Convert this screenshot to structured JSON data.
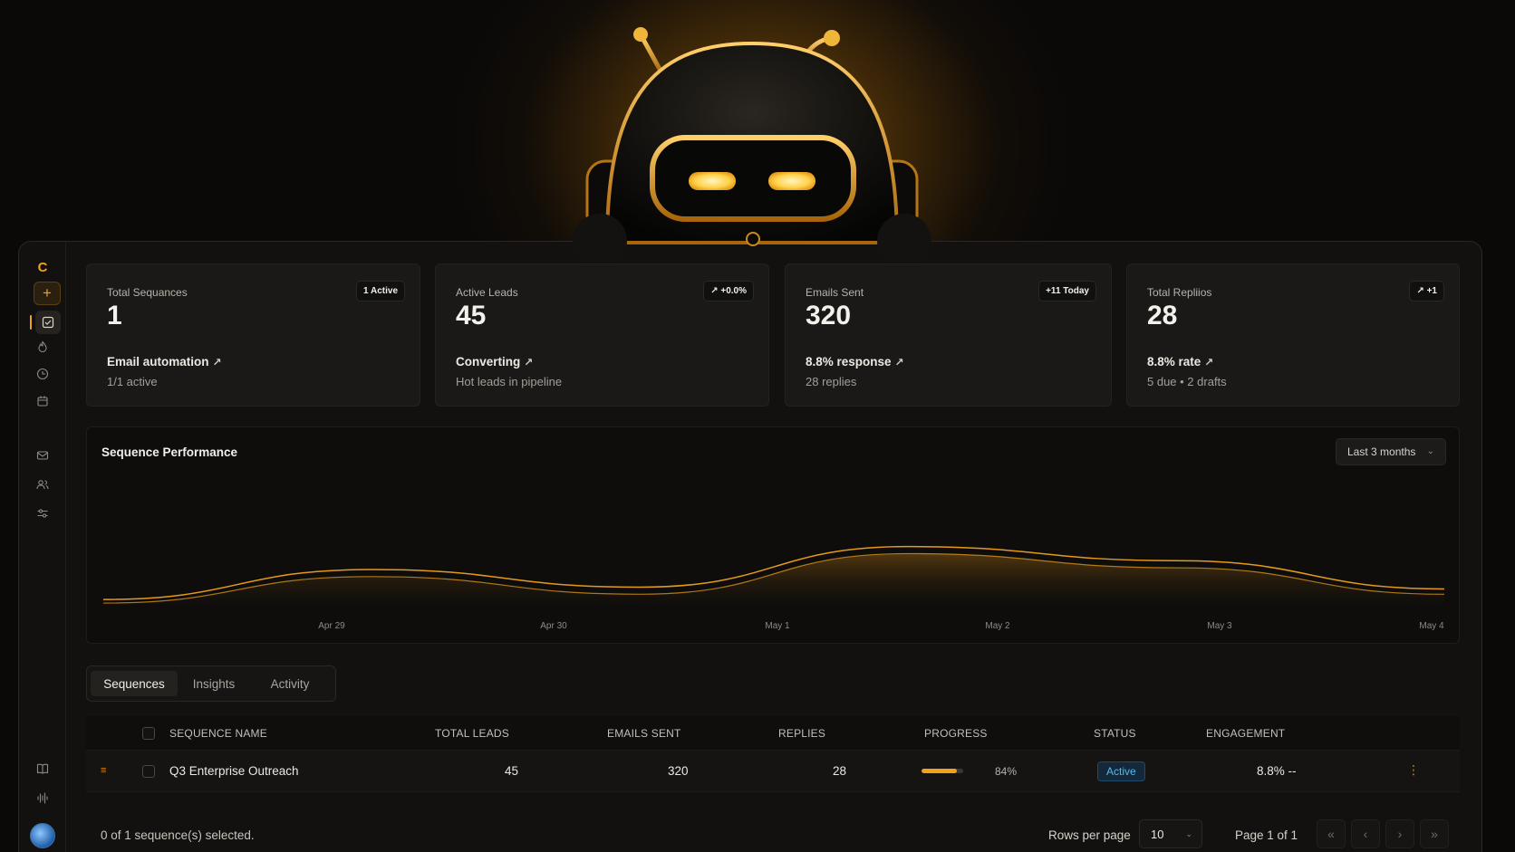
{
  "sidebar": {
    "logo_glyph": "C",
    "add_glyph": "+",
    "icons": [
      "sequences-icon",
      "fire-icon",
      "clock-icon",
      "calendar-icon",
      "mail-icon",
      "users-icon",
      "sliders-icon",
      "book-icon",
      "waveform-icon"
    ]
  },
  "stats": [
    {
      "label": "Total Sequances",
      "badge": "1 Active",
      "value": "1",
      "line1": "Email automation",
      "line1_trend": "↗",
      "line2": "1/1 active"
    },
    {
      "label": "Active Leads",
      "badge": "↗ +0.0%",
      "value": "45",
      "line1": "Converting",
      "line1_trend": "↗",
      "line2": "Hot leads in pipeline"
    },
    {
      "label": "Emails Sent",
      "badge": "+11 Today",
      "value": "320",
      "line1": "8.8% response",
      "line1_trend": "↗",
      "line2": "28 replies"
    },
    {
      "label": "Total Repliios",
      "badge": "↗ +1",
      "value": "28",
      "line1": "8.8% rate",
      "line1_trend": "↗",
      "line2": "5 due • 2 drafts"
    }
  ],
  "chart": {
    "title": "Sequence Performance",
    "range": "Last 3 months",
    "accent": "#f0a21a"
  },
  "chart_data": {
    "type": "area",
    "title": "Sequence Performance",
    "x": [
      "Apr 29",
      "Apr 30",
      "May 1",
      "May 2",
      "May 3",
      "May 4"
    ],
    "series": [
      {
        "values": [
          3,
          20,
          10,
          33,
          25,
          9
        ]
      },
      {
        "values": [
          1,
          16,
          6,
          29,
          21,
          6
        ]
      }
    ],
    "ylim": [
      0,
      80
    ],
    "grid": false,
    "xlabel": "",
    "ylabel": ""
  },
  "tabs": [
    "Sequences",
    "Insights",
    "Activity"
  ],
  "table": {
    "headers": [
      "SEQUENCE NAME",
      "TOTAL LEADS",
      "EMAILS SENT",
      "REPLIES",
      "PROGRESS",
      "STATUS",
      "ENGAGEMENT"
    ],
    "rows": [
      {
        "name": "Q3 Enterprise Outreach",
        "leads": "45",
        "sent": "320",
        "replies": "28",
        "progress": 84,
        "progress_label": "84%",
        "status": "Active",
        "engagement": "8.8% --"
      }
    ]
  },
  "footer": {
    "selected": "0 of 1 sequence(s) selected.",
    "rows_label": "Rows per page",
    "rows_value": "10",
    "page_label": "Page 1 of 1",
    "nav": [
      "«",
      "‹",
      "›",
      "»"
    ]
  }
}
